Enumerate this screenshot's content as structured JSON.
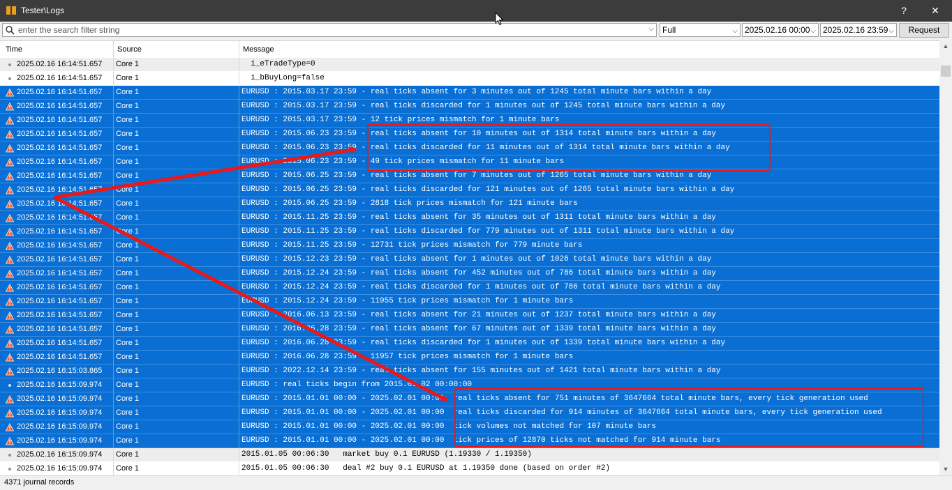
{
  "window": {
    "title": "Tester\\Logs",
    "help_label": "?",
    "close_label": "✕"
  },
  "toolbar": {
    "search_placeholder": "enter the search filter string",
    "filter_value": "Full",
    "date_from": "2025.02.16 00:00",
    "date_to": "2025.02.16 23:59",
    "request_label": "Request"
  },
  "columns": {
    "time": "Time",
    "source": "Source",
    "message": "Message"
  },
  "rows": [
    {
      "style": "gray",
      "icon": "dot",
      "time": "2025.02.16 16:14:51.657",
      "source": "Core 1",
      "message": "  i_eTradeType=0"
    },
    {
      "style": "plain",
      "icon": "dot",
      "time": "2025.02.16 16:14:51.657",
      "source": "Core 1",
      "message": "  i_bBuyLong=false"
    },
    {
      "style": "sel",
      "icon": "warn",
      "time": "2025.02.16 16:14:51.657",
      "source": "Core 1",
      "message": "EURUSD : 2015.03.17 23:59 - real ticks absent for 3 minutes out of 1245 total minute bars within a day"
    },
    {
      "style": "sel",
      "icon": "warn",
      "time": "2025.02.16 16:14:51.657",
      "source": "Core 1",
      "message": "EURUSD : 2015.03.17 23:59 - real ticks discarded for 1 minutes out of 1245 total minute bars within a day"
    },
    {
      "style": "sel",
      "icon": "warn",
      "time": "2025.02.16 16:14:51.657",
      "source": "Core 1",
      "message": "EURUSD : 2015.03.17 23:59 - 12 tick prices mismatch for 1 minute bars"
    },
    {
      "style": "sel",
      "icon": "warn",
      "time": "2025.02.16 16:14:51.657",
      "source": "Core 1",
      "message": "EURUSD : 2015.06.23 23:59 - real ticks absent for 10 minutes out of 1314 total minute bars within a day"
    },
    {
      "style": "sel",
      "icon": "warn",
      "time": "2025.02.16 16:14:51.657",
      "source": "Core 1",
      "message": "EURUSD : 2015.06.23 23:59 - real ticks discarded for 11 minutes out of 1314 total minute bars within a day"
    },
    {
      "style": "sel",
      "icon": "warn",
      "time": "2025.02.16 16:14:51.657",
      "source": "Core 1",
      "message": "EURUSD : 2015.06.23 23:59 - 49 tick prices mismatch for 11 minute bars"
    },
    {
      "style": "sel",
      "icon": "warn",
      "time": "2025.02.16 16:14:51.657",
      "source": "Core 1",
      "message": "EURUSD : 2015.06.25 23:59 - real ticks absent for 7 minutes out of 1265 total minute bars within a day"
    },
    {
      "style": "sel",
      "icon": "warn",
      "time": "2025.02.16 16:14:51.657",
      "source": "Core 1",
      "message": "EURUSD : 2015.06.25 23:59 - real ticks discarded for 121 minutes out of 1265 total minute bars within a day"
    },
    {
      "style": "sel",
      "icon": "warn",
      "time": "2025.02.16 16:14:51.657",
      "source": "Core 1",
      "message": "EURUSD : 2015.06.25 23:59 - 2818 tick prices mismatch for 121 minute bars"
    },
    {
      "style": "sel",
      "icon": "warn",
      "time": "2025.02.16 16:14:51.657",
      "source": "Core 1",
      "message": "EURUSD : 2015.11.25 23:59 - real ticks absent for 35 minutes out of 1311 total minute bars within a day"
    },
    {
      "style": "sel",
      "icon": "warn",
      "time": "2025.02.16 16:14:51.657",
      "source": "Core 1",
      "message": "EURUSD : 2015.11.25 23:59 - real ticks discarded for 779 minutes out of 1311 total minute bars within a day"
    },
    {
      "style": "sel",
      "icon": "warn",
      "time": "2025.02.16 16:14:51.657",
      "source": "Core 1",
      "message": "EURUSD : 2015.11.25 23:59 - 12731 tick prices mismatch for 779 minute bars"
    },
    {
      "style": "sel",
      "icon": "warn",
      "time": "2025.02.16 16:14:51.657",
      "source": "Core 1",
      "message": "EURUSD : 2015.12.23 23:59 - real ticks absent for 1 minutes out of 1026 total minute bars within a day"
    },
    {
      "style": "sel",
      "icon": "warn",
      "time": "2025.02.16 16:14:51.657",
      "source": "Core 1",
      "message": "EURUSD : 2015.12.24 23:59 - real ticks absent for 452 minutes out of 786 total minute bars within a day"
    },
    {
      "style": "sel",
      "icon": "warn",
      "time": "2025.02.16 16:14:51.657",
      "source": "Core 1",
      "message": "EURUSD : 2015.12.24 23:59 - real ticks discarded for 1 minutes out of 786 total minute bars within a day"
    },
    {
      "style": "sel",
      "icon": "warn",
      "time": "2025.02.16 16:14:51.657",
      "source": "Core 1",
      "message": "EURUSD : 2015.12.24 23:59 - 11955 tick prices mismatch for 1 minute bars"
    },
    {
      "style": "sel",
      "icon": "warn",
      "time": "2025.02.16 16:14:51.657",
      "source": "Core 1",
      "message": "EURUSD : 2016.06.13 23:59 - real ticks absent for 21 minutes out of 1237 total minute bars within a day"
    },
    {
      "style": "sel",
      "icon": "warn",
      "time": "2025.02.16 16:14:51.657",
      "source": "Core 1",
      "message": "EURUSD : 2016.06.28 23:59 - real ticks absent for 67 minutes out of 1339 total minute bars within a day"
    },
    {
      "style": "sel",
      "icon": "warn",
      "time": "2025.02.16 16:14:51.657",
      "source": "Core 1",
      "message": "EURUSD : 2016.06.28 23:59 - real ticks discarded for 1 minutes out of 1339 total minute bars within a day"
    },
    {
      "style": "sel",
      "icon": "warn",
      "time": "2025.02.16 16:14:51.657",
      "source": "Core 1",
      "message": "EURUSD : 2016.06.28 23:59 - 11957 tick prices mismatch for 1 minute bars"
    },
    {
      "style": "sel",
      "icon": "warn",
      "time": "2025.02.16 16:15:03.865",
      "source": "Core 1",
      "message": "EURUSD : 2022.12.14 23:59 - real ticks absent for 155 minutes out of 1421 total minute bars within a day"
    },
    {
      "style": "sel",
      "icon": "dot",
      "time": "2025.02.16 16:15:09.974",
      "source": "Core 1",
      "message": "EURUSD : real ticks begin from 2015.01.02 00:00:00"
    },
    {
      "style": "sel",
      "icon": "warn",
      "time": "2025.02.16 16:15:09.974",
      "source": "Core 1",
      "message": "EURUSD : 2015.01.01 00:00 - 2025.02.01 00:00  real ticks absent for 751 minutes of 3647664 total minute bars, every tick generation used"
    },
    {
      "style": "sel",
      "icon": "warn",
      "time": "2025.02.16 16:15:09.974",
      "source": "Core 1",
      "message": "EURUSD : 2015.01.01 00:00 - 2025.02.01 00:00  real ticks discarded for 914 minutes of 3647664 total minute bars, every tick generation used"
    },
    {
      "style": "sel",
      "icon": "warn",
      "time": "2025.02.16 16:15:09.974",
      "source": "Core 1",
      "message": "EURUSD : 2015.01.01 00:00 - 2025.02.01 00:00  tick volumes not matched for 107 minute bars"
    },
    {
      "style": "sel",
      "icon": "warn",
      "time": "2025.02.16 16:15:09.974",
      "source": "Core 1",
      "message": "EURUSD : 2015.01.01 00:00 - 2025.02.01 00:00  tick prices of 12870 ticks not matched for 914 minute bars"
    },
    {
      "style": "gray",
      "icon": "dot",
      "time": "2025.02.16 16:15:09.974",
      "source": "Core 1",
      "message": "2015.01.05 00:06:30   market buy 0.1 EURUSD (1.19330 / 1.19350)"
    },
    {
      "style": "plain",
      "icon": "dot",
      "time": "2025.02.16 16:15:09.974",
      "source": "Core 1",
      "message": "2015.01.05 00:06:30   deal #2 buy 0.1 EURUSD at 1.19350 done (based on order #2)"
    }
  ],
  "status": {
    "records": "4371 journal records"
  },
  "colors": {
    "selection": "#0a6fd4",
    "annotation": "#e8191a",
    "warning": "#e05a2b"
  },
  "icons": [
    "journal-icon",
    "search-icon",
    "warning-icon",
    "info-dot-icon",
    "arrow-icon"
  ]
}
